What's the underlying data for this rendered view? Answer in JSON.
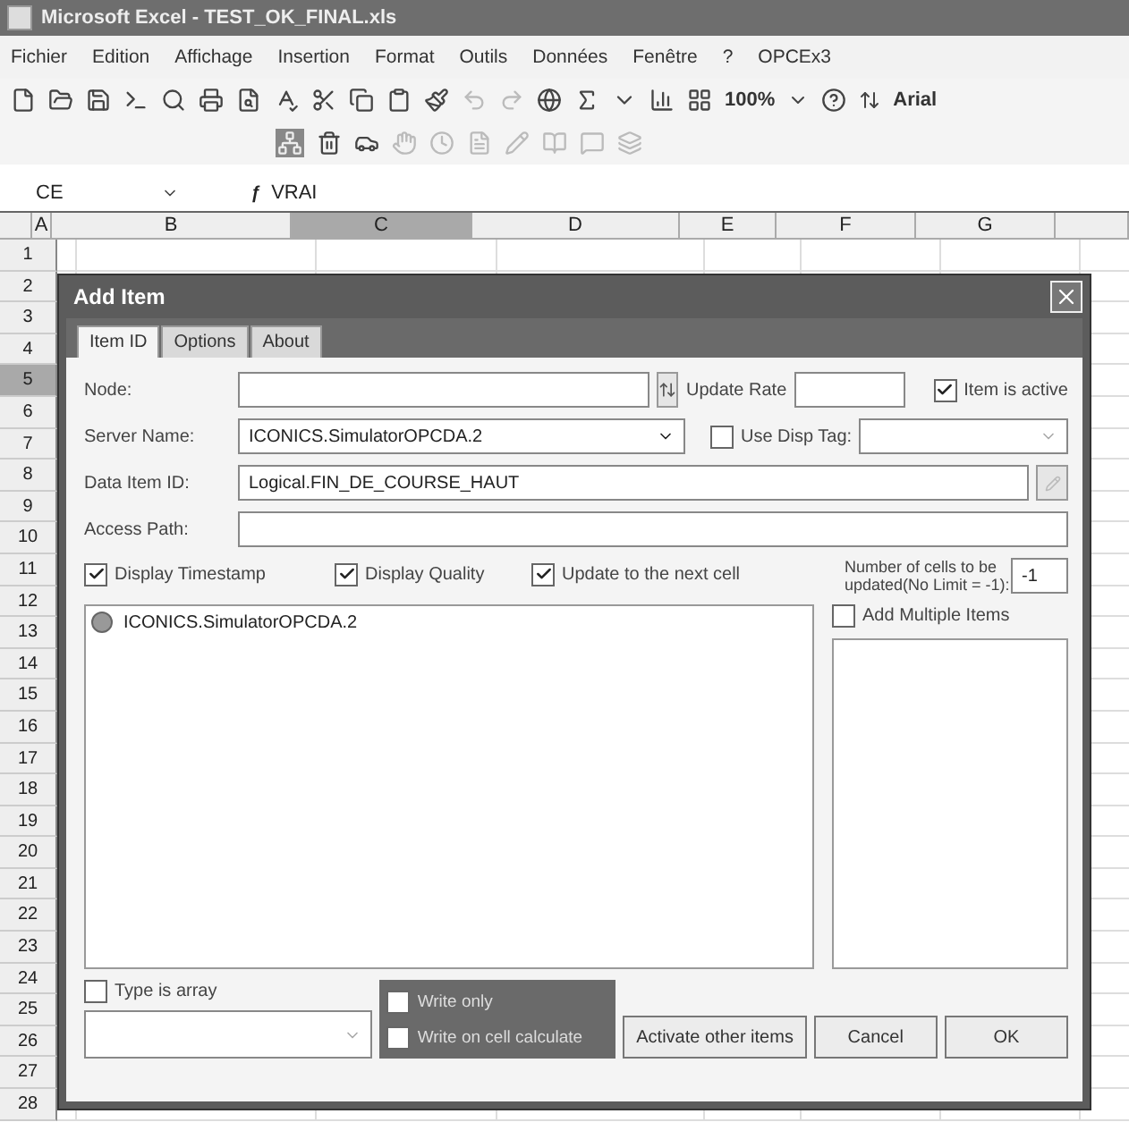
{
  "window": {
    "title": "Microsoft Excel - TEST_OK_FINAL.xls"
  },
  "menu": [
    "Fichier",
    "Edition",
    "Affichage",
    "Insertion",
    "Format",
    "Outils",
    "Données",
    "Fenêtre",
    "?",
    "OPCEx3"
  ],
  "toolbar": {
    "zoom": "100%",
    "font": "Arial"
  },
  "formula_bar": {
    "name_box": "CE",
    "fx": "ƒ",
    "value": "VRAI"
  },
  "grid": {
    "columns": [
      {
        "label": "A",
        "selected": false
      },
      {
        "label": "B",
        "selected": false
      },
      {
        "label": "C",
        "selected": true
      },
      {
        "label": "D",
        "selected": false
      },
      {
        "label": "E",
        "selected": false
      },
      {
        "label": "F",
        "selected": false
      },
      {
        "label": "G",
        "selected": false
      }
    ],
    "rows": [
      {
        "label": "1",
        "selected": false
      },
      {
        "label": "2",
        "selected": false
      },
      {
        "label": "3",
        "selected": false
      },
      {
        "label": "4",
        "selected": false
      },
      {
        "label": "5",
        "selected": true
      },
      {
        "label": "6",
        "selected": false
      },
      {
        "label": "7",
        "selected": false
      },
      {
        "label": "8",
        "selected": false
      },
      {
        "label": "9",
        "selected": false
      },
      {
        "label": "10",
        "selected": false
      },
      {
        "label": "11",
        "selected": false
      },
      {
        "label": "12",
        "selected": false
      },
      {
        "label": "13",
        "selected": false
      },
      {
        "label": "14",
        "selected": false
      },
      {
        "label": "15",
        "selected": false
      },
      {
        "label": "16",
        "selected": false
      },
      {
        "label": "17",
        "selected": false
      },
      {
        "label": "18",
        "selected": false
      },
      {
        "label": "19",
        "selected": false
      },
      {
        "label": "20",
        "selected": false
      },
      {
        "label": "21",
        "selected": false
      },
      {
        "label": "22",
        "selected": false
      },
      {
        "label": "23",
        "selected": false
      },
      {
        "label": "24",
        "selected": false
      },
      {
        "label": "25",
        "selected": false
      },
      {
        "label": "26",
        "selected": false
      },
      {
        "label": "27",
        "selected": false
      },
      {
        "label": "28",
        "selected": false
      }
    ]
  },
  "dialog": {
    "title": "Add Item",
    "tabs": [
      {
        "label": "Item ID",
        "selected": true
      },
      {
        "label": "Options",
        "selected": false
      },
      {
        "label": "About",
        "selected": false
      }
    ],
    "node": {
      "label": "Node:"
    },
    "update_rate": {
      "label": "Update Rate"
    },
    "item_active": {
      "label": "Item is active",
      "checked": true
    },
    "server_name": {
      "label": "Server Name:",
      "value": "ICONICS.SimulatorOPCDA.2"
    },
    "use_disp_tag": {
      "label": "Use Disp Tag:",
      "checked": false
    },
    "data_item_id": {
      "label": "Data Item ID:",
      "value": "Logical.FIN_DE_COURSE_HAUT"
    },
    "access_path": {
      "label": "Access Path:"
    },
    "options": [
      {
        "label": "Display Timestamp",
        "checked": true
      },
      {
        "label": "Display Quality",
        "checked": true
      },
      {
        "label": "Update to the next cell",
        "checked": true
      }
    ],
    "cells_count": {
      "label": "Number of cells to be updated(No Limit = -1):",
      "value": "-1"
    },
    "tree": [
      {
        "label": "ICONICS.SimulatorOPCDA.2"
      }
    ],
    "add_multiple": {
      "label": "Add Multiple Items",
      "checked": false
    },
    "type_is_array": {
      "label": "Type is array",
      "checked": false
    },
    "write_options": [
      {
        "label": "Write only",
        "checked": false
      },
      {
        "label": "Write on cell calculate",
        "checked": false
      }
    ],
    "buttons": [
      "Activate other items",
      "Cancel",
      "OK"
    ]
  }
}
